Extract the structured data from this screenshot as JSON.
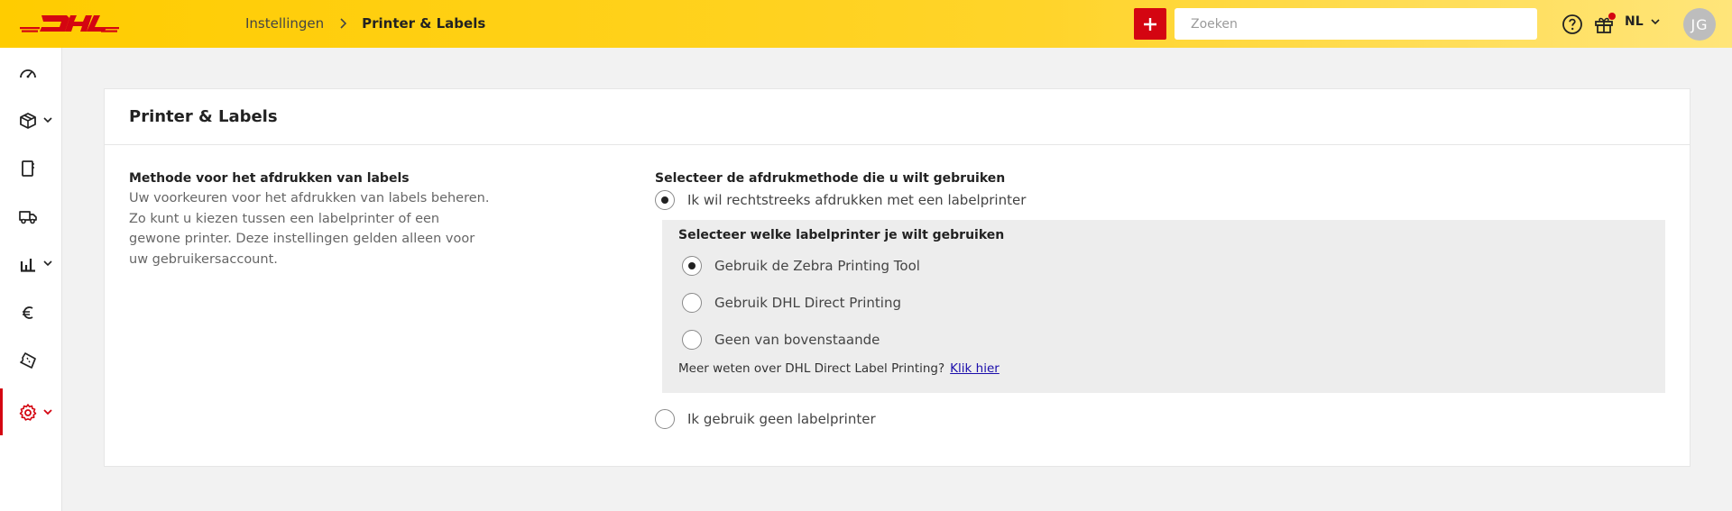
{
  "header": {
    "breadcrumb": {
      "parent": "Instellingen",
      "current": "Printer & Labels"
    },
    "add_label": "+",
    "search_placeholder": "Zoeken",
    "language": "NL",
    "avatar_initials": "JG",
    "brand_color": "#ffcc00",
    "accent_color": "#d40511"
  },
  "sidebar": {
    "items": [
      {
        "icon": "dashboard-icon",
        "has_chevron": false,
        "active": false
      },
      {
        "icon": "package-icon",
        "has_chevron": true,
        "active": false
      },
      {
        "icon": "document-icon",
        "has_chevron": false,
        "active": false
      },
      {
        "icon": "truck-icon",
        "has_chevron": false,
        "active": false
      },
      {
        "icon": "bar-chart-icon",
        "has_chevron": true,
        "active": false
      },
      {
        "icon": "euro-icon",
        "has_chevron": false,
        "active": false
      },
      {
        "icon": "ticket-icon",
        "has_chevron": false,
        "active": false
      },
      {
        "icon": "gear-icon",
        "has_chevron": true,
        "active": true
      }
    ]
  },
  "card": {
    "title": "Printer & Labels",
    "left": {
      "title": "Methode voor het afdrukken van labels",
      "description": "Uw voorkeuren voor het afdrukken van labels beheren. Zo kunt u kiezen tussen een labelprinter of een gewone printer. Deze instellingen gelden alleen voor uw gebruikersaccount."
    },
    "right": {
      "title": "Selecteer de afdrukmethode die u wilt gebruiken",
      "option_direct": "Ik wil rechtstreeks afdrukken met een labelprinter",
      "sub": {
        "title": "Selecteer welke labelprinter je wilt gebruiken",
        "option_zebra": "Gebruik de Zebra Printing Tool",
        "option_dhl": "Gebruik DHL Direct Printing",
        "option_none": "Geen van bovenstaande",
        "info_text": "Meer weten over DHL Direct Label Printing?",
        "info_link": "Klik hier"
      },
      "option_no_printer": "Ik gebruik geen labelprinter"
    }
  }
}
